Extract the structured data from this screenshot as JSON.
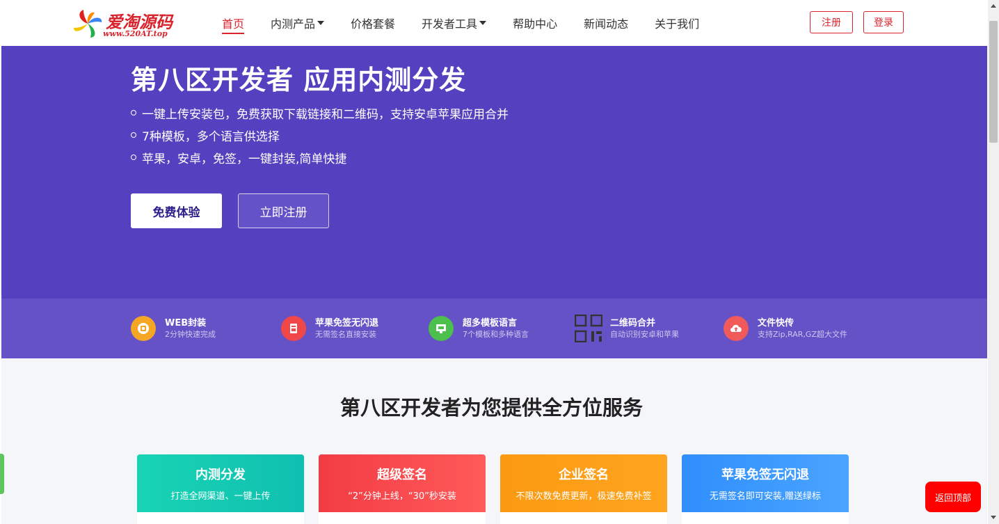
{
  "header": {
    "logo_text": "爱淘源码",
    "logo_url": "www.520AT.top",
    "nav": [
      {
        "label": "首页",
        "active": true,
        "dropdown": false
      },
      {
        "label": "内测产品",
        "active": false,
        "dropdown": true
      },
      {
        "label": "价格套餐",
        "active": false,
        "dropdown": false
      },
      {
        "label": "开发者工具",
        "active": false,
        "dropdown": true
      },
      {
        "label": "帮助中心",
        "active": false,
        "dropdown": false
      },
      {
        "label": "新闻动态",
        "active": false,
        "dropdown": false
      },
      {
        "label": "关于我们",
        "active": false,
        "dropdown": false
      }
    ],
    "register_label": "注册",
    "login_label": "登录"
  },
  "hero": {
    "title": "第八区开发者 应用内测分发",
    "bullets": [
      "一键上传安装包，免费获取下载链接和二维码，支持安卓苹果应用合并",
      "7种模板，多个语言供选择",
      "苹果，安卓，免签，一键封装,简单快捷"
    ],
    "primary_button": "免费体验",
    "secondary_button": "立即注册"
  },
  "features": [
    {
      "icon": "web-package-icon",
      "title": "WEB封装",
      "sub": "2分钟快速完成",
      "color": "#f5a623"
    },
    {
      "icon": "apple-nosign-icon",
      "title": "苹果免签无闪退",
      "sub": "无需签名直接安装",
      "color": "#f04848"
    },
    {
      "icon": "template-icon",
      "title": "超多模板语言",
      "sub": "7个模板和多种语言",
      "color": "#4cc04c"
    },
    {
      "icon": "qrcode-icon",
      "title": "二维码合并",
      "sub": "自动识别安卓和苹果",
      "color": "#333333"
    },
    {
      "icon": "cloud-upload-icon",
      "title": "文件快传",
      "sub": "支持Zip,RAR,GZ超大文件",
      "color": "#f05a5a"
    }
  ],
  "services": {
    "title": "第八区开发者为您提供全方位服务",
    "cards": [
      {
        "title": "内测分发",
        "sub": "打造全网渠道、一键上传",
        "color_from": "#19d4b4",
        "color_to": "#0fbfb0"
      },
      {
        "title": "超级签名",
        "sub": "“2”分钟上线，“30”秒安装",
        "color_from": "#f23c44",
        "color_to": "#ff5a5a"
      },
      {
        "title": "企业签名",
        "sub": "不限次数免费更新，极速免费补签",
        "color_from": "#fb9a12",
        "color_to": "#ffa41e"
      },
      {
        "title": "苹果免签无闪退",
        "sub": "无需签名即可安装,赠送绿标",
        "color_from": "#2f8efb",
        "color_to": "#4aa4ff"
      }
    ]
  },
  "back_to_top": "返回顶部",
  "colors": {
    "brand_red": "#d9232d",
    "hero_purple": "#5540c0",
    "strip_purple": "#6452c6"
  }
}
